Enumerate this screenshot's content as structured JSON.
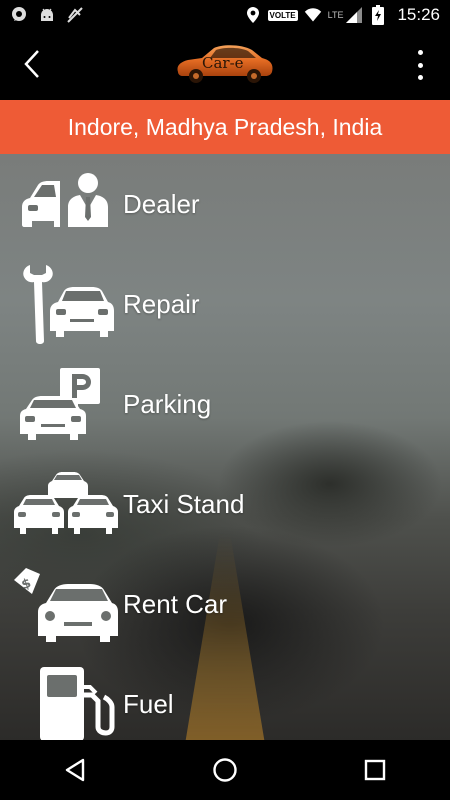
{
  "status_bar": {
    "time": "15:26",
    "volte": "VOLTE",
    "network": "LTE",
    "icons": [
      "chat-icon",
      "android-icon",
      "no-sync-icon",
      "location-icon",
      "wifi-icon",
      "signal-icon",
      "battery-charging-icon"
    ]
  },
  "app_bar": {
    "logo_text": "Car-e",
    "back_icon": "back-arrow-icon",
    "menu_icon": "overflow-menu-icon"
  },
  "location": "Indore, Madhya Pradesh, India",
  "menu": [
    {
      "label": "Dealer",
      "icon": "car-dealer-icon"
    },
    {
      "label": "Repair",
      "icon": "car-repair-icon"
    },
    {
      "label": "Parking",
      "icon": "parking-icon"
    },
    {
      "label": "Taxi Stand",
      "icon": "taxi-stand-icon"
    },
    {
      "label": "Rent Car",
      "icon": "rent-car-icon"
    },
    {
      "label": "Fuel",
      "icon": "fuel-pump-icon"
    }
  ],
  "colors": {
    "accent": "#ee5b36",
    "logo": "#e8742a"
  },
  "nav": [
    "back-nav-icon",
    "home-nav-icon",
    "recents-nav-icon"
  ]
}
